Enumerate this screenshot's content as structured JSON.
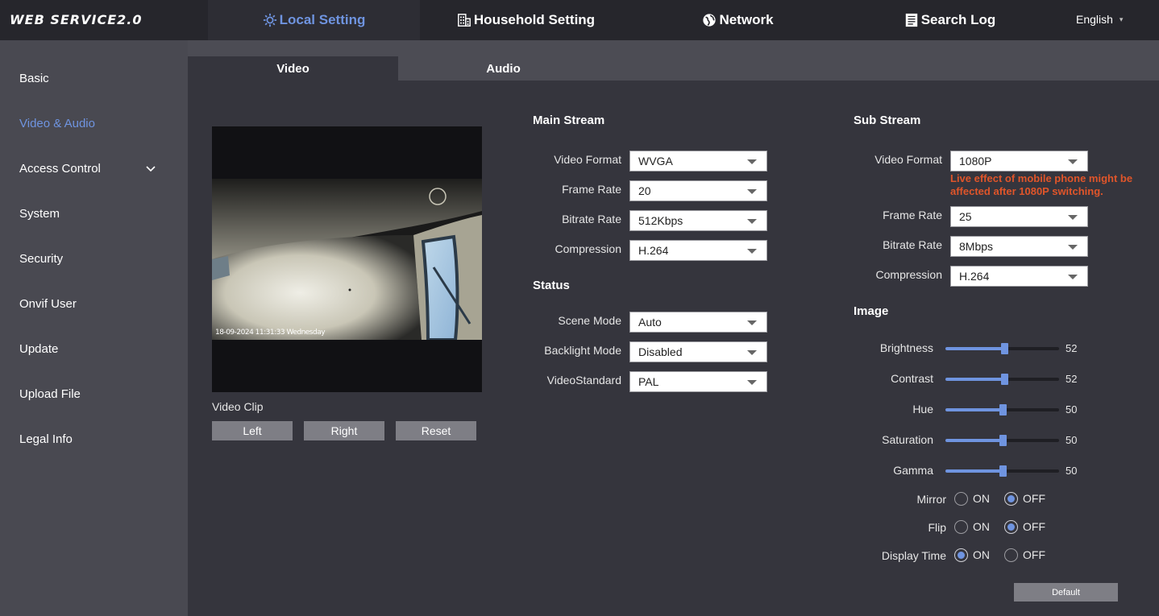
{
  "header": {
    "logo": "WEB SERVICE2.0",
    "nav": {
      "local_setting": "Local Setting",
      "household_setting": "Household Setting",
      "network": "Network",
      "search_log": "Search Log"
    },
    "language": "English"
  },
  "sidebar": {
    "items": [
      {
        "label": "Basic"
      },
      {
        "label": "Video & Audio"
      },
      {
        "label": "Access Control"
      },
      {
        "label": "System"
      },
      {
        "label": "Security"
      },
      {
        "label": "Onvif User"
      },
      {
        "label": "Update"
      },
      {
        "label": "Upload File"
      },
      {
        "label": "Legal Info"
      }
    ],
    "active_index": 1
  },
  "tabs": {
    "video": "Video",
    "audio": "Audio",
    "active": "video"
  },
  "preview": {
    "osd_text": "18-09-2024 11:31:33 Wednesday",
    "clip_label": "Video Clip",
    "buttons": {
      "left": "Left",
      "right": "Right",
      "reset": "Reset"
    }
  },
  "main_stream": {
    "title": "Main Stream",
    "video_format": {
      "label": "Video Format",
      "value": "WVGA"
    },
    "frame_rate": {
      "label": "Frame Rate",
      "value": "20"
    },
    "bitrate_rate": {
      "label": "Bitrate Rate",
      "value": "512Kbps"
    },
    "compression": {
      "label": "Compression",
      "value": "H.264"
    }
  },
  "status": {
    "title": "Status",
    "scene_mode": {
      "label": "Scene Mode",
      "value": "Auto"
    },
    "backlight_mode": {
      "label": "Backlight Mode",
      "value": "Disabled"
    },
    "video_standard": {
      "label": "VideoStandard",
      "value": "PAL"
    }
  },
  "sub_stream": {
    "title": "Sub Stream",
    "video_format": {
      "label": "Video Format",
      "value": "1080P"
    },
    "warning": "Live effect of mobile phone might be affected after 1080P switching.",
    "frame_rate": {
      "label": "Frame Rate",
      "value": "25"
    },
    "bitrate_rate": {
      "label": "Bitrate Rate",
      "value": "8Mbps"
    },
    "compression": {
      "label": "Compression",
      "value": "H.264"
    }
  },
  "image": {
    "title": "Image",
    "brightness": {
      "label": "Brightness",
      "value": 52
    },
    "contrast": {
      "label": "Contrast",
      "value": 52
    },
    "hue": {
      "label": "Hue",
      "value": 50
    },
    "saturation": {
      "label": "Saturation",
      "value": 50
    },
    "gamma": {
      "label": "Gamma",
      "value": 50
    },
    "on_label": "ON",
    "off_label": "OFF",
    "mirror": {
      "label": "Mirror",
      "value": "OFF"
    },
    "flip": {
      "label": "Flip",
      "value": "OFF"
    },
    "display_time": {
      "label": "Display Time",
      "value": "ON"
    },
    "default_button": "Default"
  },
  "colors": {
    "accent": "#6f94e0",
    "warning": "#e0552a",
    "topbar": "#26262c",
    "sidebar": "#494951"
  }
}
